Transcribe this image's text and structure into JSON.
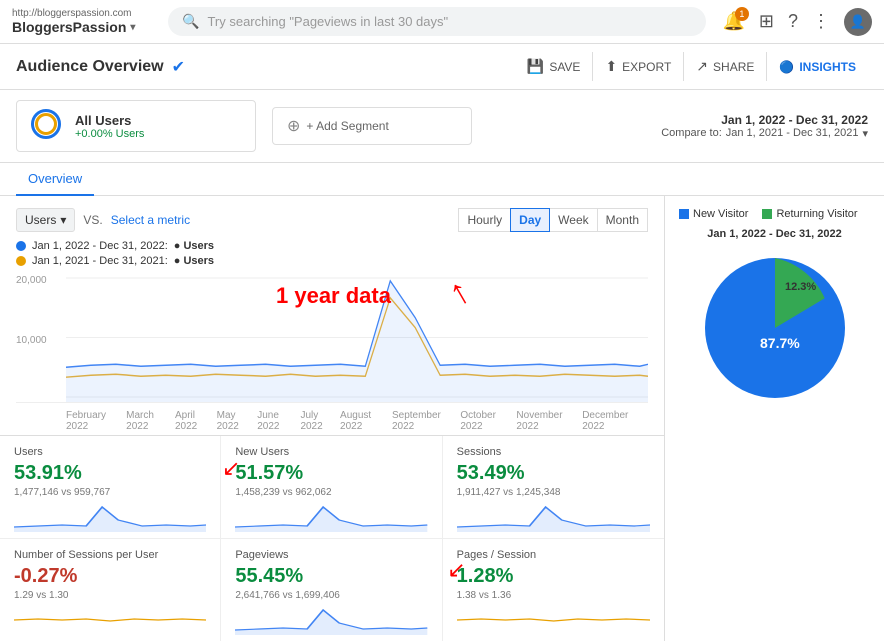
{
  "brand": {
    "url": "http://bloggerspassion.com",
    "name": "BloggersPassion",
    "chevron": "▾"
  },
  "search": {
    "placeholder": "Try searching \"Pageviews in last 30 days\""
  },
  "nav": {
    "notification_count": "1",
    "icons": [
      "grid-icon",
      "help-icon",
      "more-icon",
      "avatar-icon"
    ]
  },
  "header": {
    "title": "Audience Overview",
    "save_label": "SAVE",
    "export_label": "EXPORT",
    "share_label": "SHARE",
    "insights_label": "INSIGHTS"
  },
  "segment": {
    "name": "All Users",
    "pct": "+0.00% Users",
    "add_label": "+ Add Segment"
  },
  "date_range": {
    "main": "Jan 1, 2022 - Dec 31, 2022",
    "compare_label": "Compare to:",
    "compare_value": "Jan 1, 2021 - Dec 31, 2021"
  },
  "tabs": {
    "overview": "Overview"
  },
  "chart_controls": {
    "metric1": "Users",
    "vs": "VS.",
    "select_metric": "Select a metric",
    "time_buttons": [
      "Hourly",
      "Day",
      "Week",
      "Month"
    ],
    "active_time": "Day"
  },
  "chart_legend": [
    {
      "date": "Jan 1, 2022 - Dec 31, 2022:",
      "metric": "Users",
      "color": "blue"
    },
    {
      "date": "Jan 1, 2021 - Dec 31, 2021:",
      "metric": "Users",
      "color": "orange"
    }
  ],
  "chart": {
    "y_max": "20,000",
    "y_mid": "10,000",
    "x_labels": [
      "February 2022",
      "March 2022",
      "April 2022",
      "May 2022",
      "June 2022",
      "July 2022",
      "August 2022",
      "September 2022",
      "October 2022",
      "November 2022",
      "December 2022"
    ]
  },
  "annotation": {
    "text": "1 year data"
  },
  "metrics": [
    {
      "name": "Users",
      "pct": "53.91%",
      "color": "green",
      "values": "1,477,146 vs 959,767"
    },
    {
      "name": "New Users",
      "pct": "51.57%",
      "color": "green",
      "values": "1,458,239 vs 962,062"
    },
    {
      "name": "Sessions",
      "pct": "53.49%",
      "color": "green",
      "values": "1,911,427 vs 1,245,348"
    },
    {
      "name": "Number of Sessions per User",
      "pct": "-0.27%",
      "color": "red",
      "values": "1.29 vs 1.30"
    },
    {
      "name": "Pageviews",
      "pct": "55.45%",
      "color": "green",
      "values": "2,641,766 vs 1,699,406"
    },
    {
      "name": "Pages / Session",
      "pct": "1.28%",
      "color": "green",
      "values": "1.38 vs 1.36"
    }
  ],
  "pie": {
    "title": "Jan 1, 2022 - Dec 31, 2022",
    "legend": [
      {
        "label": "New Visitor",
        "color": "blue"
      },
      {
        "label": "Returning Visitor",
        "color": "green"
      }
    ],
    "new_visitor_pct": 87.7,
    "returning_visitor_pct": 12.3,
    "new_label": "87.7%",
    "returning_label": "12.3%"
  }
}
